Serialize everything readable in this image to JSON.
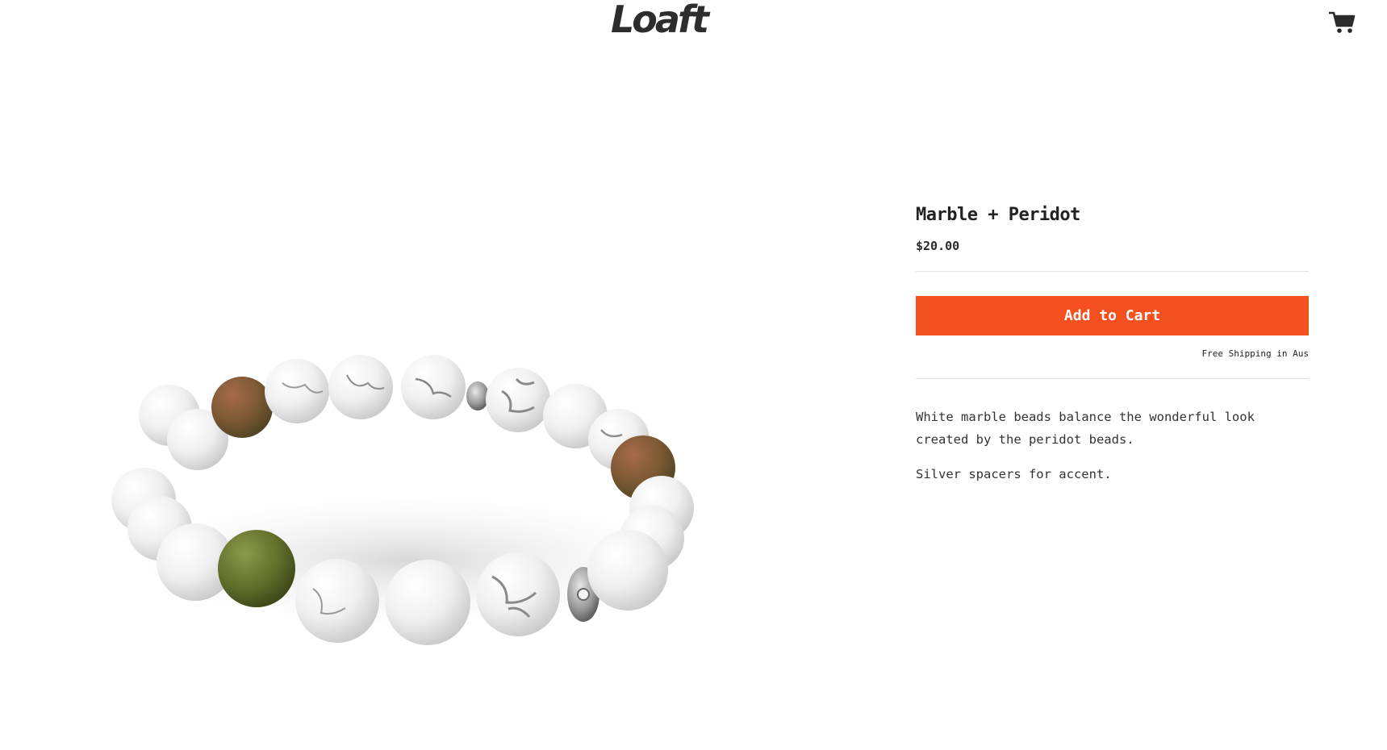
{
  "header": {
    "logo_text": "Loaft",
    "cart_icon": "cart-icon"
  },
  "product": {
    "image_alt": "bracelet-photo",
    "title": "Marble + Peridot",
    "price": "$20.00",
    "add_to_cart_label": "Add to Cart",
    "shipping_note": "Free Shipping in Aus",
    "description": [
      "White marble beads balance the wonderful look created by the peridot beads.",
      "Silver spacers for accent."
    ]
  },
  "colors": {
    "accent": "#f5501f",
    "text": "#222222",
    "divider": "#e3e3e3"
  }
}
